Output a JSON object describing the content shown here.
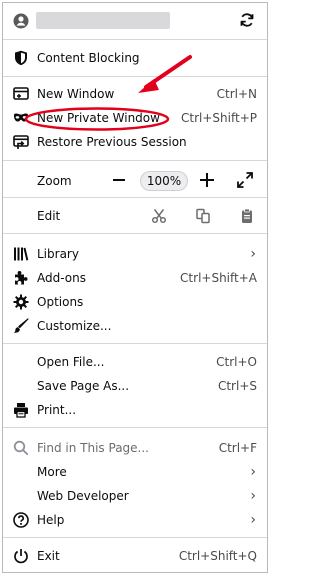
{
  "menu": {
    "account": {
      "label": "",
      "sync_icon": "sync-icon"
    },
    "content_blocking": {
      "label": "Content Blocking"
    },
    "new_window": {
      "label": "New Window",
      "shortcut": "Ctrl+N"
    },
    "new_private_window": {
      "label": "New Private Window",
      "shortcut": "Ctrl+Shift+P"
    },
    "restore_session": {
      "label": "Restore Previous Session"
    },
    "zoom": {
      "label": "Zoom",
      "minus": "—",
      "value": "100%",
      "plus": "+"
    },
    "edit": {
      "label": "Edit"
    },
    "library": {
      "label": "Library"
    },
    "addons": {
      "label": "Add-ons",
      "shortcut": "Ctrl+Shift+A"
    },
    "options": {
      "label": "Options"
    },
    "customize": {
      "label": "Customize..."
    },
    "open_file": {
      "label": "Open File...",
      "shortcut": "Ctrl+O"
    },
    "save_page": {
      "label": "Save Page As...",
      "shortcut": "Ctrl+S"
    },
    "print": {
      "label": "Print..."
    },
    "find": {
      "label": "Find in This Page...",
      "shortcut": "Ctrl+F"
    },
    "more": {
      "label": "More"
    },
    "web_developer": {
      "label": "Web Developer"
    },
    "help": {
      "label": "Help"
    },
    "exit": {
      "label": "Exit",
      "shortcut": "Ctrl+Shift+Q"
    }
  },
  "annotation": {
    "color": "#e3001b"
  }
}
